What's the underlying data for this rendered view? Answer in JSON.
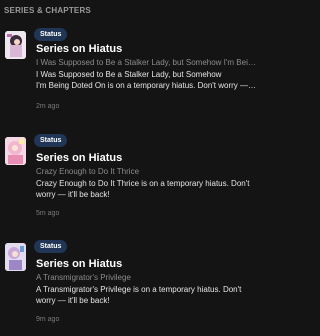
{
  "section": {
    "header": "SERIES & CHAPTERS"
  },
  "notifications": [
    {
      "badge": "Status",
      "title": "Series on Hiatus",
      "series": "I Was Supposed to Be a Stalker Lady, but Somehow I'm Being Doted On",
      "message_line1": "I Was Supposed to Be a Stalker Lady, but Somehow",
      "message_line2": "I'm Being Doted On is on a temporary hiatus. Don't worry — it'll be back!",
      "time": "2m ago",
      "thumb_icon": "cover-art-thumbnail"
    },
    {
      "badge": "Status",
      "title": "Series on Hiatus",
      "series": "Crazy Enough to Do It Thrice",
      "message": "Crazy Enough to Do It Thrice is on a temporary hiatus. Don't worry — it'll be back!",
      "time": "5m ago",
      "thumb_icon": "cover-art-thumbnail"
    },
    {
      "badge": "Status",
      "title": "Series on Hiatus",
      "series": "A Transmigrator's Privilege",
      "message": "A Transmigrator's Privilege is on a temporary hiatus. Don't worry — it'll be back!",
      "time": "9m ago",
      "thumb_icon": "cover-art-thumbnail"
    }
  ],
  "colors": {
    "background": "#141414",
    "badge_bg": "#213657",
    "title": "#ffffff",
    "secondary_text": "#8c8c8c"
  }
}
